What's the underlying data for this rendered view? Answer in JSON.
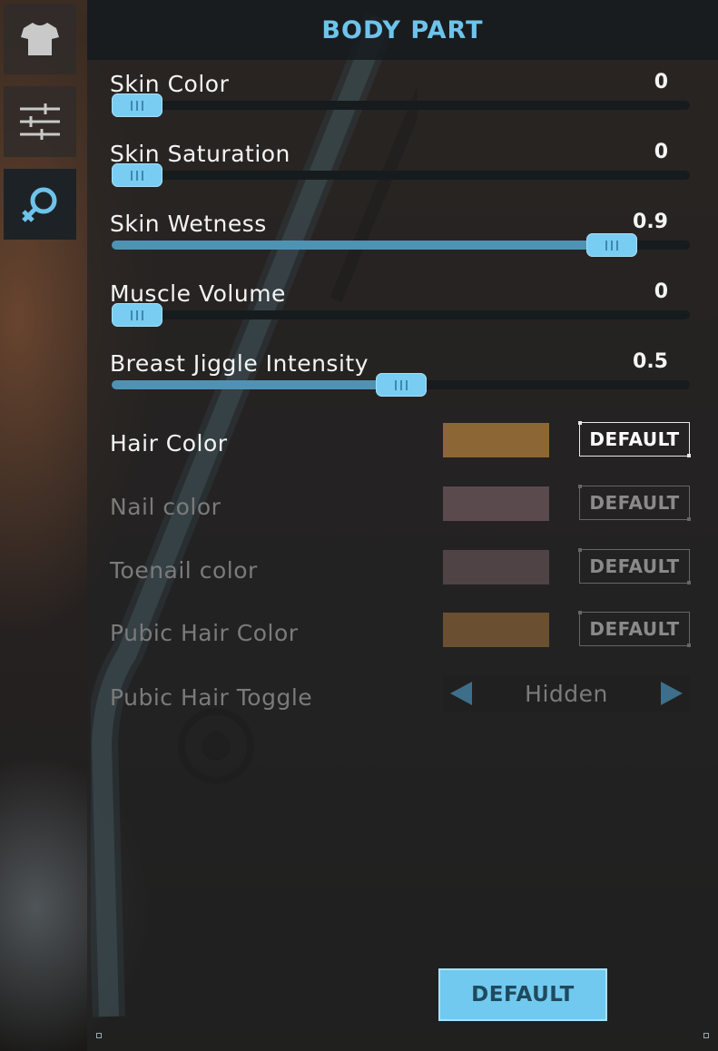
{
  "header": {
    "title": "BODY PART"
  },
  "tabs": [
    {
      "icon": "shirt-icon",
      "active": false
    },
    {
      "icon": "sliders-icon",
      "active": false
    },
    {
      "icon": "female-symbol-icon",
      "active": true
    }
  ],
  "sliders": [
    {
      "label": "Skin Color",
      "value": "0",
      "level": 0.0
    },
    {
      "label": "Skin Saturation",
      "value": "0",
      "level": 0.0
    },
    {
      "label": "Skin Wetness",
      "value": "0.9",
      "level": 0.9
    },
    {
      "label": "Muscle Volume",
      "value": "0",
      "level": 0.0
    },
    {
      "label": "Breast Jiggle Intensity",
      "value": "0.5",
      "level": 0.5
    }
  ],
  "colors": [
    {
      "label": "Hair Color",
      "swatch": "#8d6636",
      "button": "DEFAULT",
      "enabled": true
    },
    {
      "label": "Nail color",
      "swatch": "#5b4a4d",
      "button": "DEFAULT",
      "enabled": false
    },
    {
      "label": "Toenail color",
      "swatch": "#4f4346",
      "button": "DEFAULT",
      "enabled": false
    },
    {
      "label": "Pubic Hair Color",
      "swatch": "#6a5030",
      "button": "DEFAULT",
      "enabled": false
    }
  ],
  "pubic_toggle": {
    "label": "Pubic Hair Toggle",
    "value": "Hidden"
  },
  "footer": {
    "default_label": "DEFAULT"
  },
  "theme": {
    "accent": "#6ec3ea",
    "slider_fill": "#4f93b4",
    "knob": "#79cdf2"
  }
}
